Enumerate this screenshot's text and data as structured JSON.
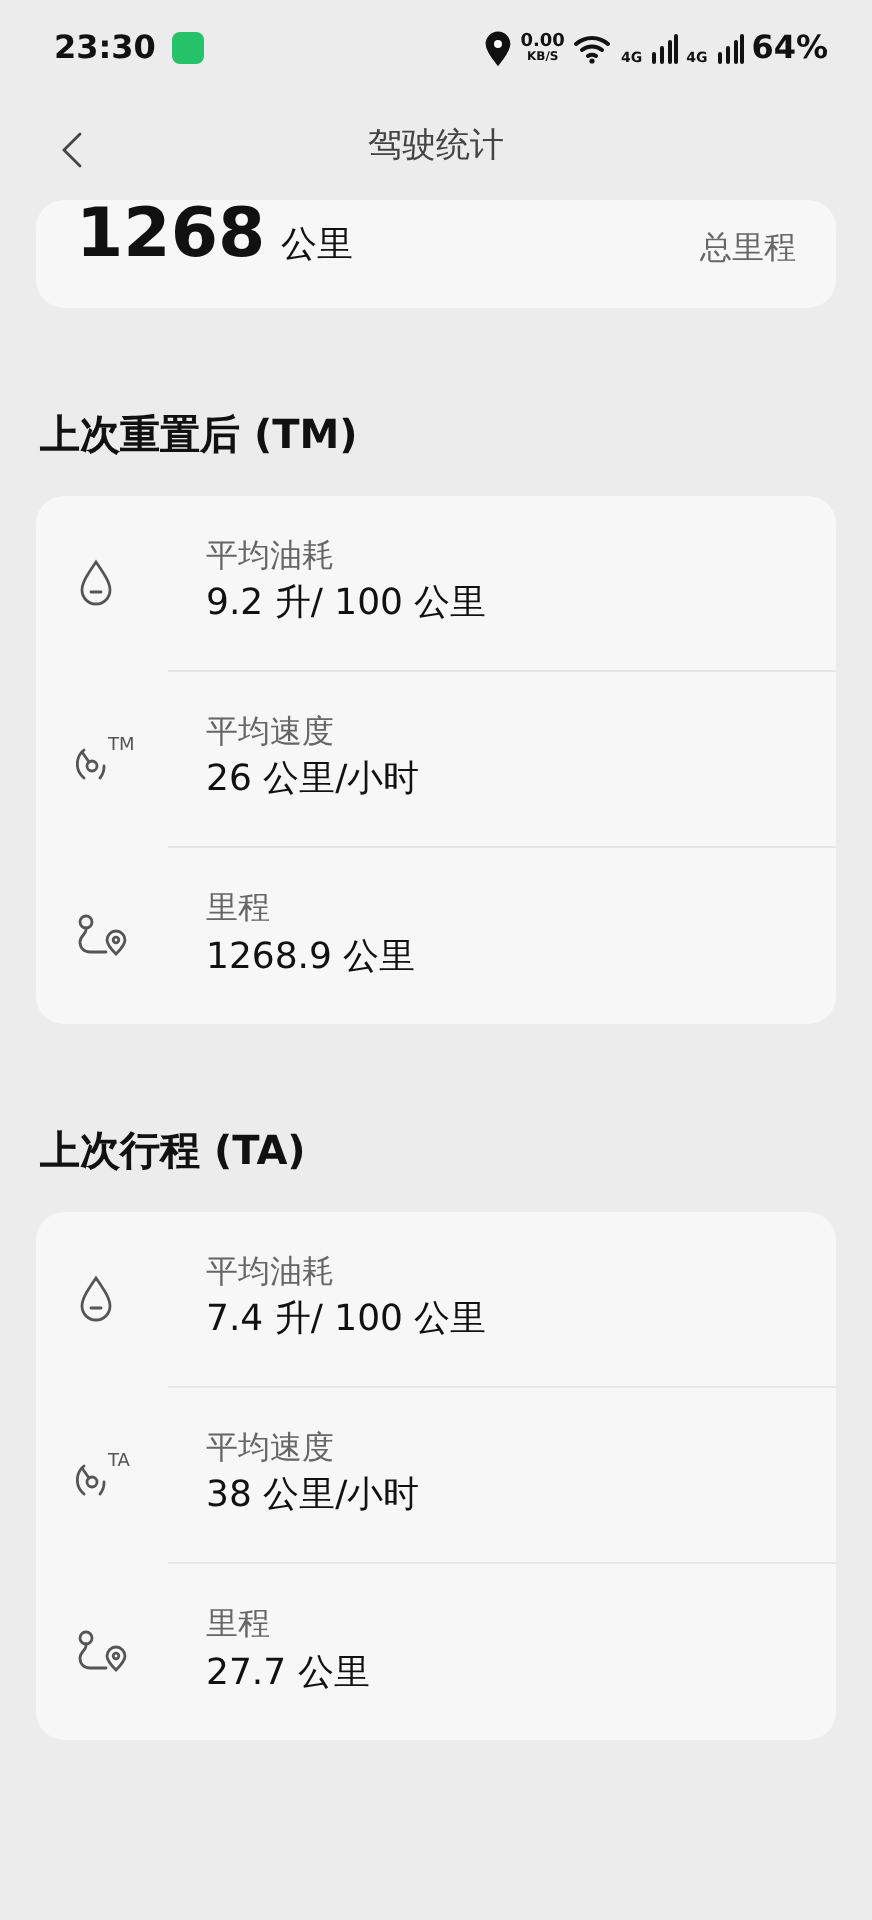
{
  "status_bar": {
    "time": "23:30",
    "net_speed": "0.00",
    "net_unit": "KB/S",
    "sim1": "4G",
    "sim2": "4G",
    "battery": "64%"
  },
  "header": {
    "title": "驾驶统计"
  },
  "total": {
    "value": "1268",
    "unit": "公里",
    "label": "总里程"
  },
  "sections": [
    {
      "title": "上次重置后 (TM)",
      "rows": [
        {
          "kind": "fuel",
          "label": "平均油耗",
          "value": "9.2 升/ 100 公里"
        },
        {
          "kind": "speed",
          "badge": "TM",
          "label": "平均速度",
          "value": "26 公里/小时"
        },
        {
          "kind": "distance",
          "label": "里程",
          "value": "1268.9 公里"
        }
      ]
    },
    {
      "title": "上次行程 (TA)",
      "rows": [
        {
          "kind": "fuel",
          "label": "平均油耗",
          "value": "7.4 升/ 100 公里"
        },
        {
          "kind": "speed",
          "badge": "TA",
          "label": "平均速度",
          "value": "38 公里/小时"
        },
        {
          "kind": "distance",
          "label": "里程",
          "value": "27.7 公里"
        }
      ]
    }
  ]
}
